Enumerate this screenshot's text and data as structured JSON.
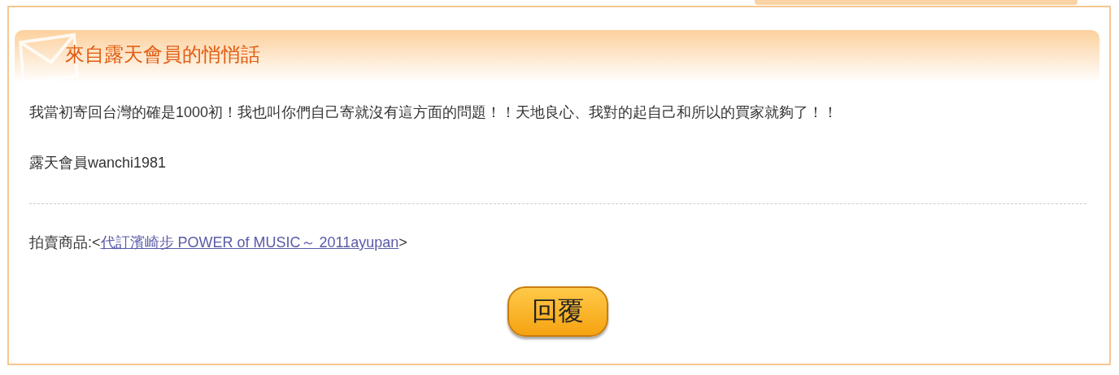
{
  "header": {
    "title": "來自露天會員的悄悄話"
  },
  "message": {
    "body": "我當初寄回台灣的確是1000初！我也叫你們自己寄就沒有這方面的問題！！天地良心、我對的起自己和所以的買家就夠了！！",
    "signature": "露天會員wanchi1981"
  },
  "item": {
    "label": "拍賣商品:<",
    "link": "代訂濱崎步 POWER of MUSIC～ 2011ayupan",
    "suffix": ">"
  },
  "buttons": [
    {
      "label": "回覆"
    }
  ]
}
